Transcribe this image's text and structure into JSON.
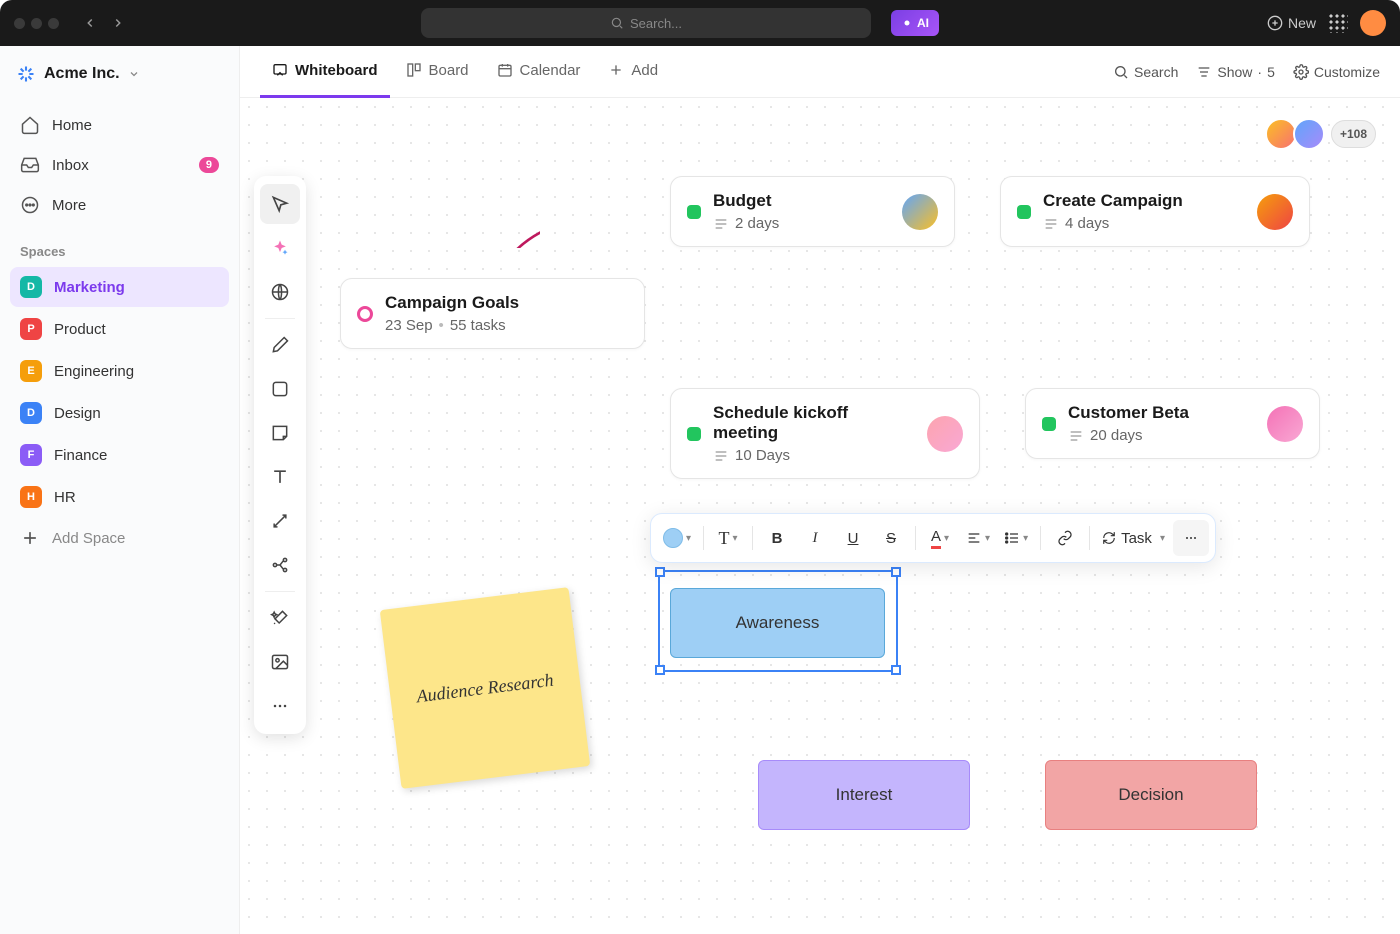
{
  "topbar": {
    "search_placeholder": "Search...",
    "ai_label": "AI",
    "new_label": "New"
  },
  "workspace": {
    "name": "Acme Inc."
  },
  "sidebar": {
    "home": "Home",
    "inbox": "Inbox",
    "inbox_badge": "9",
    "more": "More",
    "spaces_label": "Spaces",
    "add_space": "Add Space",
    "spaces": [
      {
        "letter": "D",
        "label": "Marketing",
        "color": "#14b8a6",
        "active": true
      },
      {
        "letter": "P",
        "label": "Product",
        "color": "#ef4444"
      },
      {
        "letter": "E",
        "label": "Engineering",
        "color": "#f59e0b"
      },
      {
        "letter": "D",
        "label": "Design",
        "color": "#3b82f6"
      },
      {
        "letter": "F",
        "label": "Finance",
        "color": "#8b5cf6"
      },
      {
        "letter": "H",
        "label": "HR",
        "color": "#f97316"
      }
    ]
  },
  "viewbar": {
    "tabs": [
      {
        "label": "Whiteboard",
        "active": true
      },
      {
        "label": "Board"
      },
      {
        "label": "Calendar"
      },
      {
        "label": "Add"
      }
    ],
    "search": "Search",
    "show": "Show",
    "show_count": "5",
    "customize": "Customize"
  },
  "canvas": {
    "avatar_more": "+108",
    "cards": {
      "goals": {
        "title": "Campaign Goals",
        "date": "23 Sep",
        "tasks": "55 tasks"
      },
      "budget": {
        "title": "Budget",
        "duration": "2 days"
      },
      "create": {
        "title": "Create Campaign",
        "duration": "4 days"
      },
      "kickoff": {
        "title": "Schedule kickoff meeting",
        "duration": "10 Days"
      },
      "beta": {
        "title": "Customer Beta",
        "duration": "20 days"
      }
    },
    "sticky": "Audience Research",
    "flow": {
      "awareness": "Awareness",
      "interest": "Interest",
      "decision": "Decision"
    },
    "toolbar": {
      "task": "Task"
    }
  }
}
